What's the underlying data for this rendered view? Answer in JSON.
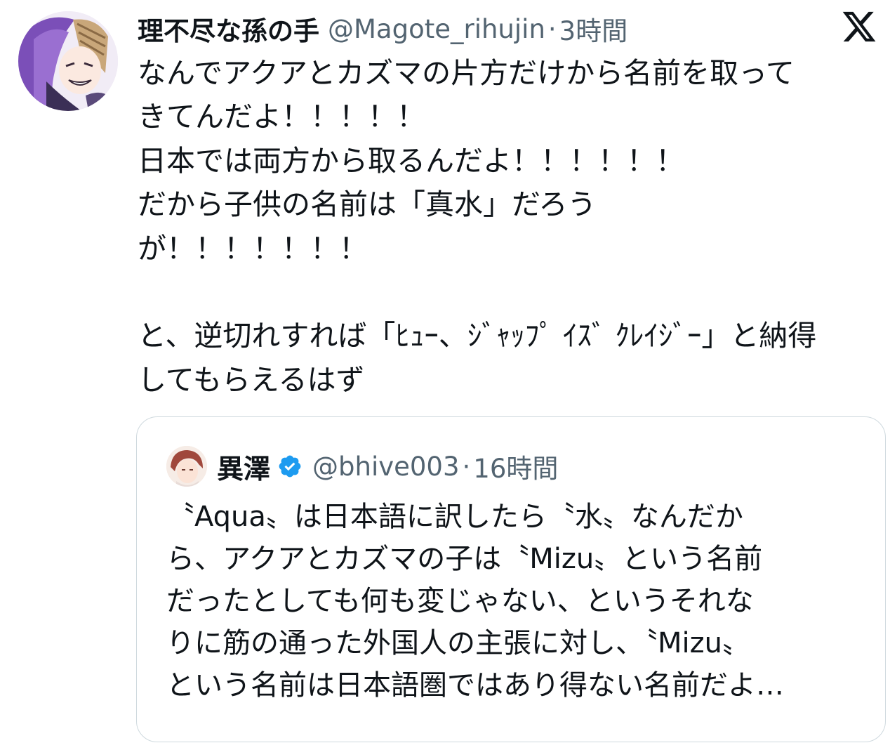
{
  "tweet": {
    "author": {
      "display_name": "理不尽な孫の手",
      "handle": "@Magote_rihujin",
      "avatar_icon": "anime-character-avatar"
    },
    "separator": "·",
    "time": "3時間",
    "platform_logo": "x-logo-icon",
    "text_lines": [
      "なんでアクアとカズマの片方だけから名前を取って",
      "きてんだよ！！！！！",
      "日本では両方から取るんだよ！！！！！！",
      "だから子供の名前は「真水」だろう",
      "が！！！！！！！",
      "",
      "と、逆切れすれば「ﾋｭｰ、ｼﾞｬｯﾌﾟ ｲｽﾞ ｸﾚｲｼﾞｰ」と納得",
      "してもらえるはず"
    ]
  },
  "quoted": {
    "author": {
      "display_name": "異澤",
      "handle": "@bhive003",
      "verified": true,
      "avatar_icon": "anime-character-avatar"
    },
    "separator": "·",
    "time": "16時間",
    "text_lines": [
      "〝Aqua〟は日本語に訳したら〝水〟なんだか",
      "ら、アクアとカズマの子は〝Mizu〟という名前",
      "だったとしても何も変じゃない、というそれな",
      "りに筋の通った外国人の主張に対し、〝Mizu〟",
      "という名前は日本語圏ではあり得ない名前だよ…"
    ]
  },
  "colors": {
    "text": "#0f1419",
    "secondary": "#536471",
    "border": "#cfd9de",
    "verified_blue": "#1d9bf0"
  }
}
